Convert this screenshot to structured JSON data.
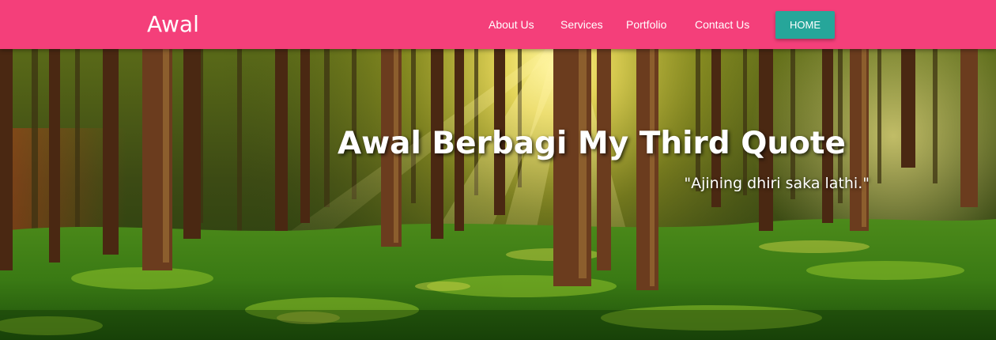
{
  "navbar": {
    "brand": "Awal",
    "links": [
      "About Us",
      "Services",
      "Portfolio",
      "Contact Us"
    ],
    "home_button": "HOME"
  },
  "hero": {
    "title": "Awal Berbagi My Third Quote",
    "quote": "\"Ajining dhiri saka lathi.\"",
    "background": "forest-sunlight-image"
  },
  "colors": {
    "navbar": "#f43f7a",
    "home_button": "#26a69a",
    "text": "#ffffff"
  }
}
